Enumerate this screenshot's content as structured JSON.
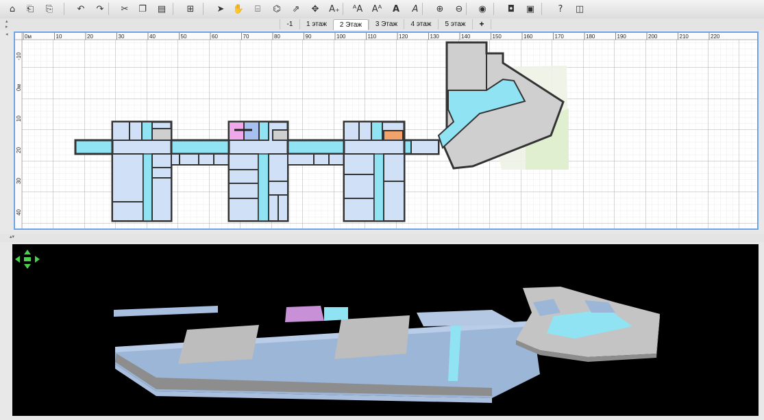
{
  "toolbar": {
    "buttons": [
      {
        "name": "new-home-icon",
        "glyph": "⌂"
      },
      {
        "name": "open-icon",
        "glyph": "⎗"
      },
      {
        "name": "save-icon",
        "glyph": "⎘"
      },
      {
        "name": "undo-icon",
        "glyph": "↶"
      },
      {
        "name": "redo-icon",
        "glyph": "↷"
      },
      {
        "name": "cut-icon",
        "glyph": "✂"
      },
      {
        "name": "copy-icon",
        "glyph": "❐"
      },
      {
        "name": "paste-icon",
        "glyph": "▤"
      },
      {
        "name": "add-furniture-icon",
        "glyph": "⊞"
      },
      {
        "name": "select-icon",
        "glyph": "➤"
      },
      {
        "name": "pan-icon",
        "glyph": "✋"
      },
      {
        "name": "create-rooms-icon",
        "glyph": "⌸"
      },
      {
        "name": "create-polylines-icon",
        "glyph": "⌬"
      },
      {
        "name": "create-dimensions-icon",
        "glyph": "⇗"
      },
      {
        "name": "create-walls-icon",
        "glyph": "✥"
      },
      {
        "name": "add-text-icon",
        "glyph": "A₊"
      },
      {
        "name": "increase-text-size-icon",
        "glyph": "ᴬA"
      },
      {
        "name": "decrease-text-size-icon",
        "glyph": "Aᴬ"
      },
      {
        "name": "bold-text-icon",
        "glyph": "A"
      },
      {
        "name": "italic-text-icon",
        "glyph": "A"
      },
      {
        "name": "zoom-in-icon",
        "glyph": "⊕"
      },
      {
        "name": "zoom-out-icon",
        "glyph": "⊖"
      },
      {
        "name": "aerial-view-icon",
        "glyph": "◉"
      },
      {
        "name": "create-photo-icon",
        "glyph": "◘"
      },
      {
        "name": "create-video-icon",
        "glyph": "▣"
      },
      {
        "name": "help-icon",
        "glyph": "?"
      },
      {
        "name": "about-icon",
        "glyph": "◫"
      }
    ]
  },
  "levels": {
    "tabs": [
      "-1",
      "1 этаж",
      "2 Этаж",
      "3 Этаж",
      "4 этаж",
      "5 этаж",
      "+"
    ],
    "active_index": 2
  },
  "plan": {
    "ruler_x": [
      "0м",
      "10",
      "20",
      "30",
      "40",
      "50",
      "60",
      "70",
      "80",
      "90",
      "100",
      "110",
      "120",
      "130",
      "140",
      "150",
      "160",
      "170",
      "180",
      "190",
      "200",
      "210",
      "220"
    ],
    "ruler_y": [
      "-10",
      "0м",
      "10",
      "20",
      "30",
      "40"
    ]
  },
  "colors": {
    "corridor": "#8fe3f2",
    "room": "#cfe0f7",
    "wall": "#333333",
    "pink_room": "#f0a8ea",
    "orange_room": "#f2a36b",
    "gray_room": "#cfcfcf",
    "plan_border": "#6fa3e8",
    "navigator": "#4dd04d"
  }
}
